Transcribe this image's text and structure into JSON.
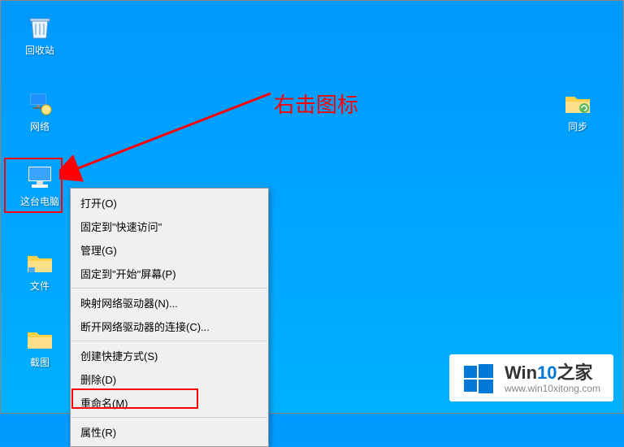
{
  "desktop": {
    "recycle_bin": "回收站",
    "network": "网络",
    "this_pc": "这台电脑",
    "files": "文件",
    "screenshot": "截图",
    "sync": "同步"
  },
  "annotation": {
    "text": "右击图标"
  },
  "context_menu": {
    "open": "打开(O)",
    "pin_quick": "固定到\"快速访问\"",
    "manage": "管理(G)",
    "pin_start": "固定到\"开始\"屏幕(P)",
    "map_drive": "映射网络驱动器(N)...",
    "disconnect_drive": "断开网络驱动器的连接(C)...",
    "create_shortcut": "创建快捷方式(S)",
    "delete": "删除(D)",
    "rename": "重命名(M)",
    "properties": "属性(R)"
  },
  "watermark": {
    "brand_prefix": "Win",
    "brand_num": "10",
    "brand_suffix": "之家",
    "url": "www.win10xitong.com"
  }
}
